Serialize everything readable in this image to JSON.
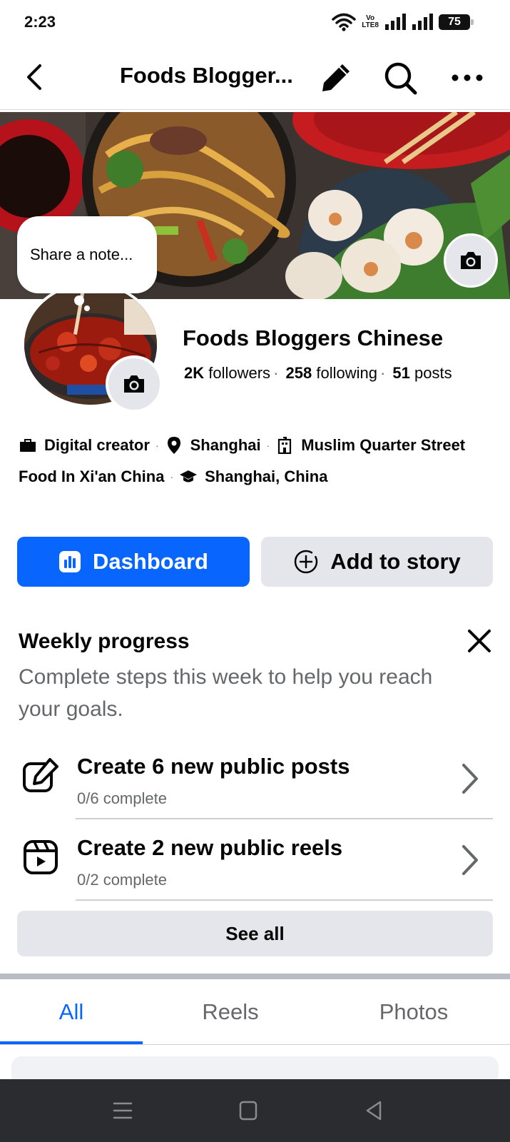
{
  "status_bar": {
    "time": "2:23",
    "volte_top": "Vo",
    "volte_bottom": "LTE8",
    "battery": "75"
  },
  "header": {
    "title": "Foods Blogger..."
  },
  "note": {
    "placeholder": "Share a note..."
  },
  "profile": {
    "name": "Foods Bloggers Chinese",
    "followers_count": "2K",
    "followers_label": "followers",
    "following_count": "258",
    "following_label": "following",
    "posts_count": "51",
    "posts_label": "posts"
  },
  "details": {
    "category": "Digital creator",
    "location": "Shanghai",
    "workplace_line1": "Muslim Quarter Street",
    "workplace_line2": "Food In Xi'an China",
    "education": "Shanghai, China"
  },
  "actions": {
    "dashboard": "Dashboard",
    "add_to_story": "Add to story"
  },
  "weekly_progress": {
    "title": "Weekly progress",
    "subtitle": "Complete steps this week to help you reach your goals.",
    "tasks": [
      {
        "title": "Create 6 new public posts",
        "progress": "0/6 complete"
      },
      {
        "title": "Create 2 new public reels",
        "progress": "0/2 complete"
      }
    ],
    "see_all": "See all"
  },
  "tabs": [
    {
      "label": "All",
      "active": true
    },
    {
      "label": "Reels",
      "active": false
    },
    {
      "label": "Photos",
      "active": false
    }
  ],
  "colors": {
    "accent": "#0866ff",
    "secondary_button": "#e4e6eb",
    "muted_text": "#65676b"
  }
}
